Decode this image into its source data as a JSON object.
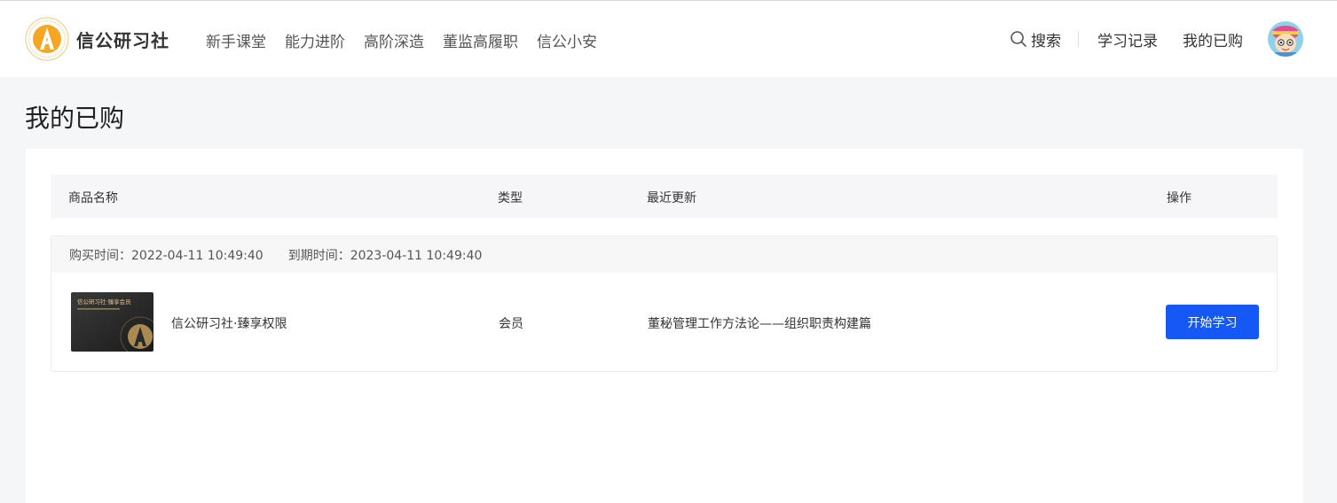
{
  "header": {
    "brand": "信公研习社",
    "nav": [
      "新手课堂",
      "能力进阶",
      "高阶深造",
      "董监高履职",
      "信公小安"
    ],
    "search_label": "搜索",
    "study_record": "学习记录",
    "my_purchases": "我的已购"
  },
  "page": {
    "title": "我的已购"
  },
  "table": {
    "headers": {
      "name": "商品名称",
      "type": "类型",
      "update": "最近更新",
      "action": "操作"
    }
  },
  "order": {
    "purchase_label": "购买时间：",
    "purchase_time": "2022-04-11 10:49:40",
    "expire_label": "到期时间：",
    "expire_time": "2023-04-11 10:49:40",
    "thumb_text": "信公研习社·臻享会员",
    "product_name": "信公研习社·臻享权限",
    "product_type": "会员",
    "latest_update": "董秘管理工作方法论——组织职责构建篇",
    "action_label": "开始学习"
  },
  "colors": {
    "primary": "#1558f6",
    "brand_orange": "#f5a623",
    "page_bg": "#f5f6f8"
  }
}
